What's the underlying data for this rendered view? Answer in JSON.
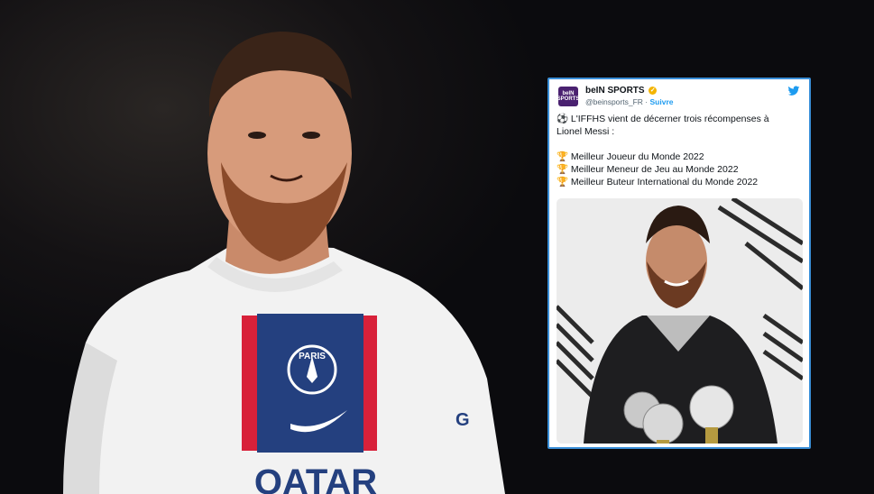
{
  "tweet": {
    "avatar_text": "beIN SPORTS",
    "display_name": "beIN SPORTS",
    "handle": "@beinsports_FR",
    "separator": "·",
    "follow_label": "Suivre",
    "lines": [
      "L'IFFHS vient de décerner trois récompenses à",
      "Lionel Messi :",
      "Meilleur Joueur du Monde 2022",
      "Meilleur Meneur de Jeu au Monde 2022",
      "Meilleur Buteur International du Monde 2022"
    ],
    "emojis": {
      "ball": "⚽",
      "trophy": "🏆"
    }
  },
  "jersey": {
    "club_badge_text": "PARIS",
    "sponsor_text": "QATAR",
    "sleeve_text": "G"
  },
  "colors": {
    "card_border": "#3a8fd8",
    "follow": "#1d9bf0",
    "verified": "#f4b400",
    "avatar_bg": "#4a2170"
  }
}
